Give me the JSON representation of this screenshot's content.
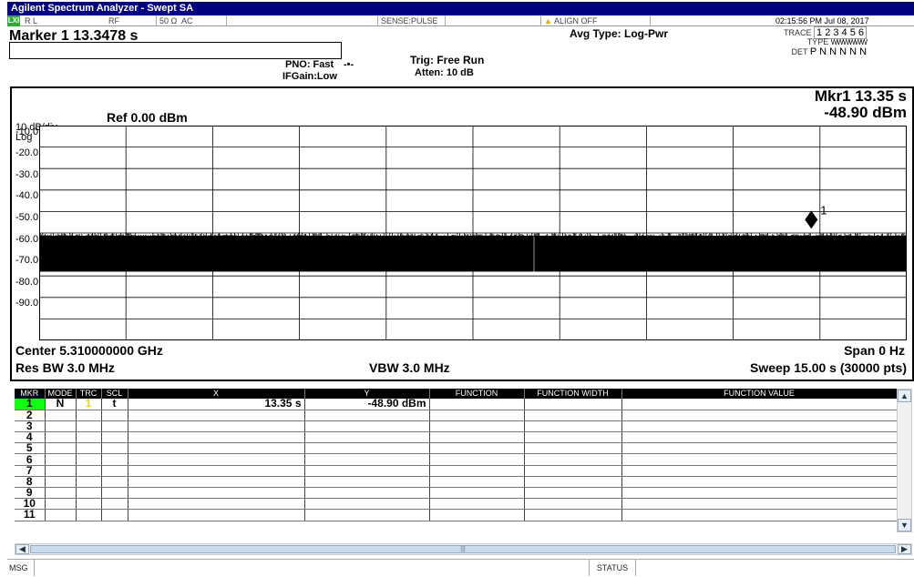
{
  "title": "Agilent Spectrum Analyzer - Swept SA",
  "status_bar": {
    "rl_icon": "LXI",
    "rl": "R L",
    "rf": "RF",
    "impedance": "50 Ω",
    "coupling": "AC",
    "sense": "SENSE:PULSE",
    "align_warning_icon": "warning-triangle-icon",
    "align": "ALIGN OFF",
    "datetime": "02:15:56 PM Jul 08, 2017"
  },
  "marker_readout": "Marker 1 13.3478 s",
  "settings": {
    "pno": "PNO: Fast",
    "ifgain": "IFGain:Low",
    "trig": "Trig: Free Run",
    "atten": "Atten: 10 dB",
    "avg_type": "Avg Type: Log-Pwr"
  },
  "trace_table": {
    "trace_label": "TRACE",
    "trace_value": "1 2 3 4 5 6",
    "type_label": "TYPE",
    "type_value": "WWWWWW",
    "det_label": "DET",
    "det_value": "P N N N N N"
  },
  "display": {
    "scale_div": "10 dB/div",
    "scale_type": "Log",
    "ref_level": "Ref 0.00 dBm",
    "mkr_time": "Mkr1 13.35 s",
    "mkr_level": "-48.90 dBm",
    "marker_label": "1",
    "center": "Center 5.310000000 GHz",
    "span": "Span 0 Hz",
    "res_bw": "Res BW 3.0 MHz",
    "vbw": "VBW 3.0 MHz",
    "sweep": "Sweep  15.00 s (30000 pts)"
  },
  "chart_data": {
    "type": "line",
    "y_tick_labels": [
      "-10.0",
      "-20.0",
      "-30.0",
      "-40.0",
      "-50.0",
      "-60.0",
      "-70.0",
      "-80.0",
      "-90.0"
    ],
    "ylim": [
      -100,
      0
    ],
    "xlim": [
      0,
      15
    ],
    "grid": true,
    "series": [
      {
        "values_band": {
          "upper": -50,
          "lower": -68
        }
      }
    ],
    "marker": {
      "x": 13.35,
      "y": -48.9
    }
  },
  "marker_table": {
    "headers": [
      "MKR",
      "MODE",
      "TRC",
      "SCL",
      "X",
      "Y",
      "FUNCTION",
      "FUNCTION WIDTH",
      "FUNCTION VALUE"
    ],
    "rows": [
      [
        "1",
        "N",
        "1",
        "t",
        "13.35 s",
        "-48.90 dBm",
        "",
        "",
        ""
      ],
      [
        "2",
        "",
        "",
        "",
        "",
        "",
        "",
        "",
        ""
      ],
      [
        "3",
        "",
        "",
        "",
        "",
        "",
        "",
        "",
        ""
      ],
      [
        "4",
        "",
        "",
        "",
        "",
        "",
        "",
        "",
        ""
      ],
      [
        "5",
        "",
        "",
        "",
        "",
        "",
        "",
        "",
        ""
      ],
      [
        "6",
        "",
        "",
        "",
        "",
        "",
        "",
        "",
        ""
      ],
      [
        "7",
        "",
        "",
        "",
        "",
        "",
        "",
        "",
        ""
      ],
      [
        "8",
        "",
        "",
        "",
        "",
        "",
        "",
        "",
        ""
      ],
      [
        "9",
        "",
        "",
        "",
        "",
        "",
        "",
        "",
        ""
      ],
      [
        "10",
        "",
        "",
        "",
        "",
        "",
        "",
        "",
        ""
      ],
      [
        "11",
        "",
        "",
        "",
        "",
        "",
        "",
        "",
        ""
      ]
    ]
  },
  "bottom": {
    "msg": "MSG",
    "status": "STATUS"
  },
  "colors": {
    "title_bg": "#000080",
    "selected_marker": "#11ff11",
    "trace": "#000000"
  }
}
